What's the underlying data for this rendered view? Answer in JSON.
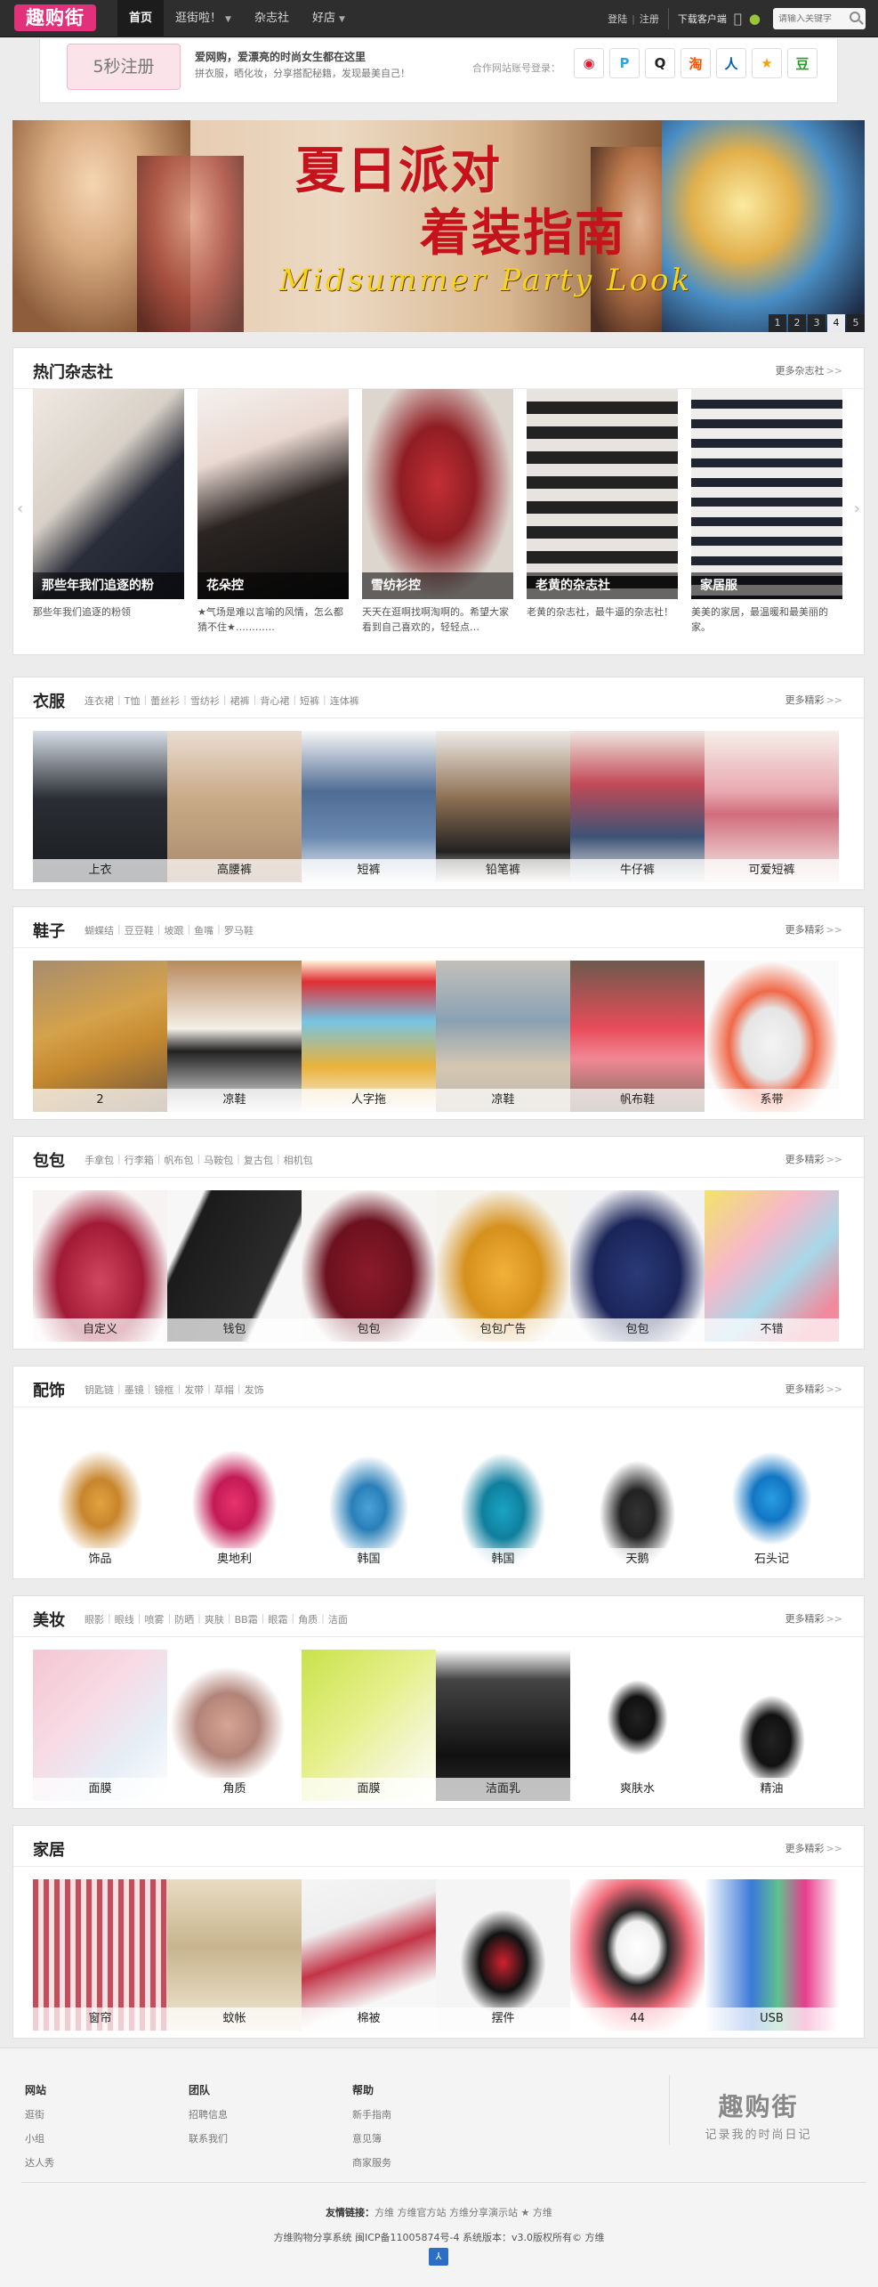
{
  "topbar": {
    "logo": "趣购街",
    "nav": [
      {
        "label": "首页",
        "active": true,
        "dropdown": false
      },
      {
        "label": "逛街啦！",
        "active": false,
        "dropdown": true
      },
      {
        "label": "杂志社",
        "active": false,
        "dropdown": false
      },
      {
        "label": "好店",
        "active": false,
        "dropdown": true
      }
    ],
    "login": "登陆",
    "register": "注册",
    "download": "下载客户端",
    "search_placeholder": "请输入关键字"
  },
  "regbar": {
    "button": "5秒注册",
    "slogan": "爱网购，爱漂亮的时尚女生都在这里",
    "subslogan": "拼衣服，晒化妆，分享搭配秘籍，发现最美自己！",
    "partner_label": "合作网站账号登录：",
    "partners": [
      {
        "icon": "weibo-icon",
        "glyph": "◉",
        "color": "#e6162d"
      },
      {
        "icon": "pengyou-icon",
        "glyph": "P",
        "color": "#2ea7e0"
      },
      {
        "icon": "qq-icon",
        "glyph": "Q",
        "color": "#222222"
      },
      {
        "icon": "taobao-icon",
        "glyph": "淘",
        "color": "#ff5000"
      },
      {
        "icon": "renren-icon",
        "glyph": "人",
        "color": "#005eac"
      },
      {
        "icon": "kaixin-icon",
        "glyph": "★",
        "color": "#f7a000"
      },
      {
        "icon": "douban-icon",
        "glyph": "豆",
        "color": "#2f9833"
      }
    ]
  },
  "banner": {
    "title1": "夏日派对",
    "title2": "着装指南",
    "subtitle": "Midsummer Party Look",
    "dots": [
      "1",
      "2",
      "3",
      "4",
      "5"
    ],
    "active_dot": 4
  },
  "magazine": {
    "title": "热门杂志社",
    "more": "更多杂志社",
    "items": [
      {
        "caption": "那些年我们追逐的粉",
        "desc": "那些年我们追逐的粉领",
        "bg": "linear-gradient(135deg,#efe9e1 0%,#d9d1c8 40%,#2b2e3a 60%,#1b1f2b 100%)"
      },
      {
        "caption": "花朵控",
        "desc": "★气场是难以言喻的风情，怎么都猜不住★…………",
        "bg": "linear-gradient(160deg,#f4f1ee 0%,#ead9d2 30%,#2a2422 55%,#111 100%)"
      },
      {
        "caption": "雪纺衫控",
        "desc": "天天在逛啊找啊淘啊的。希望大家看到自己喜欢的，轻轻点…",
        "bg": "radial-gradient(ellipse at 50% 45%,#c22f34 0,#8f1d24 35%,#ddd6cf 70%)"
      },
      {
        "caption": "老黄的杂志社",
        "desc": "老黄的杂志社，最牛逼的杂志社！",
        "bg": "repeating-linear-gradient(180deg,#e7e3df 0 14px,#222 14px 28px)"
      },
      {
        "caption": "家居服",
        "desc": "美美的家居，最温暖和最美丽的家。",
        "bg": "repeating-linear-gradient(180deg,#f0eeec 0 12px,#1f2430 12px 22px)"
      }
    ]
  },
  "sections": [
    {
      "name": "clothing",
      "title": "衣服",
      "tags": [
        "连衣裙",
        "T恤",
        "蕾丝衫",
        "雪纺衫",
        "裙裤",
        "背心裙",
        "短裤",
        "连体裤"
      ],
      "more": "更多精彩",
      "items": [
        {
          "label": "上衣",
          "bg": "linear-gradient(180deg,#d6dde6 0%,#2a2d33 45%,#1a1c20 100%)"
        },
        {
          "label": "高腰裤",
          "bg": "linear-gradient(180deg,#e9ddd2 0%,#c9aa86 45%,#a88a6e 100%)"
        },
        {
          "label": "短裤",
          "bg": "linear-gradient(180deg,#f6f6f6 0%,#4f6d94 40%,#6a89b0 70%,#f4f4f4 100%)"
        },
        {
          "label": "铅笔裤",
          "bg": "linear-gradient(180deg,#efece8 0%,#8c6f52 45%,#222 80%,#efece8 100%)"
        },
        {
          "label": "牛仔裤",
          "bg": "linear-gradient(180deg,#efe6e0 0%,#c24a56 35%,#3d5376 70%,#ece9e6 100%)"
        },
        {
          "label": "可爱短裤",
          "bg": "linear-gradient(180deg,#f6efe9 0%,#e8a9b1 40%,#d16d7c 55%,#f5f0ec 100%)"
        }
      ]
    },
    {
      "name": "shoes",
      "title": "鞋子",
      "tags": [
        "蝴蝶结",
        "豆豆鞋",
        "坡跟",
        "鱼嘴",
        "罗马鞋"
      ],
      "more": "更多精彩",
      "items": [
        {
          "label": "2",
          "bg": "linear-gradient(160deg,#a78c6d 0%,#d4a24b 40%,#c68a30 60%,#6d543c 100%)"
        },
        {
          "label": "凉鞋",
          "bg": "linear-gradient(180deg,#b88a5d 0%,#f4efe8 45%,#222 60%,#f2f2f2 100%)"
        },
        {
          "label": "人字拖",
          "bg": "linear-gradient(180deg,#fff4d8 0%,#e12e34 14%,#76c4e3 40%,#e9b23a 70%,#f5f5f5 100%)"
        },
        {
          "label": "凉鞋",
          "bg": "linear-gradient(180deg,#c3c0ba 0%,#8aa1b3 40%,#d5c7b1 70%,#bdb7ad 100%)"
        },
        {
          "label": "帆布鞋",
          "bg": "linear-gradient(180deg,#6c5a4c 0%,#e84c5a 45%,#f08894 65%,#7a6a5c 100%)"
        },
        {
          "label": "系带",
          "bg": "radial-gradient(ellipse at 50% 55%,#f4f4f4 0,#e5e5e5 30%,#f06848 45%,#fafafa 70%)"
        }
      ]
    },
    {
      "name": "bags",
      "title": "包包",
      "tags": [
        "手拿包",
        "行李箱",
        "帆布包",
        "马鞍包",
        "复古包",
        "相机包"
      ],
      "more": "更多精彩",
      "items": [
        {
          "label": "自定义",
          "bg": "radial-gradient(ellipse at 50% 60%,#d2455f 0,#a11a36 45%,#f7f3f3 75%)"
        },
        {
          "label": "钱包",
          "bg": "linear-gradient(115deg,#f7f7f7 0%,#f7f7f7 18%,#1b1b1b 22%,#2b2b2b 70%,#f7f7f7 74%)"
        },
        {
          "label": "包包",
          "bg": "radial-gradient(ellipse at 50% 55%,#8a1a2b 0,#6c111f 45%,#f7f5f4 72%)"
        },
        {
          "label": "包包广告",
          "bg": "radial-gradient(ellipse at 50% 55%,#f1b23a 0,#d6901c 40%,#f5f3ee 72%)"
        },
        {
          "label": "包包",
          "bg": "radial-gradient(ellipse at 50% 55%,#2a3a78 0,#1a2458 45%,#f3f3f6 75%)"
        },
        {
          "label": "不错",
          "bg": "linear-gradient(135deg,#f2e46a 0%,#f6b8c8 35%,#a7d7e8 60%,#f08a9c 85%)"
        }
      ]
    },
    {
      "name": "accessories",
      "title": "配饰",
      "tags": [
        "钥匙链",
        "墨镜",
        "镜框",
        "发带",
        "草帽",
        "发饰"
      ],
      "more": "更多精彩",
      "items": [
        {
          "label": "饰品",
          "bg": "radial-gradient(ellipse at 50% 55%,#e2a343 0,#c8852c 20%,#fff 45%)"
        },
        {
          "label": "奥地利",
          "bg": "radial-gradient(ellipse at 50% 55%,#e8336e 0,#c31a55 22%,#fff 45%)"
        },
        {
          "label": "韩国",
          "bg": "radial-gradient(ellipse at 50% 58%,#4aa3d8 0,#2a7fb8 18%,#fff 42%)"
        },
        {
          "label": "韩国",
          "bg": "radial-gradient(ellipse at 50% 60%,#1ba4c4 0,#0f7f9d 22%,#fff 45%)"
        },
        {
          "label": "天鹅",
          "bg": "radial-gradient(ellipse at 50% 62%,#333 0,#222 18%,#fff 40%)"
        },
        {
          "label": "石头记",
          "bg": "radial-gradient(ellipse at 50% 52%,#2a9ee3 0,#1176c4 20%,#fff 42%)"
        }
      ]
    },
    {
      "name": "makeup",
      "title": "美妆",
      "tags": [
        "眼影",
        "眼线",
        "喷雾",
        "防晒",
        "爽肤",
        "BB霜",
        "眼霜",
        "角质",
        "洁面"
      ],
      "more": "更多精彩",
      "items": [
        {
          "label": "面膜",
          "bg": "linear-gradient(135deg,#f3c6d3 0%,#f7dbe4 40%,#e6eef6 70%,#fff 100%)"
        },
        {
          "label": "角质",
          "bg": "radial-gradient(ellipse at 45% 50%,#d7a494 0,#b28479 30%,#fff 55%)"
        },
        {
          "label": "面膜",
          "bg": "linear-gradient(135deg,#c9e24a 0%,#e6f08c 45%,#f1f5c6 70%,#fff 100%)"
        },
        {
          "label": "洁面乳",
          "bg": "linear-gradient(180deg,#fff 0%,#444 20%,#111 70%,#2b2b2b 100%)"
        },
        {
          "label": "爽肤水",
          "bg": "radial-gradient(ellipse at 50% 45%,#222 0,#111 18%,#fff 32%)"
        },
        {
          "label": "精油",
          "bg": "radial-gradient(ellipse at 50% 60%,#222 0,#111 20%,#fff 35%)"
        }
      ]
    },
    {
      "name": "home",
      "title": "家居",
      "tags": [],
      "more": "更多精彩",
      "items": [
        {
          "label": "窗帘",
          "bg": "repeating-linear-gradient(90deg,#c84b5a 0 6px,#f4e2e2 6px 12px)"
        },
        {
          "label": "蚊帐",
          "bg": "linear-gradient(180deg,#e8dcc2 0%,#c8b58f 45%,#f0e7d4 100%)"
        },
        {
          "label": "棉被",
          "bg": "linear-gradient(160deg,#f5f5f5 0%,#eee 30%,#c23447 50%,#f7f7f7 75%)"
        },
        {
          "label": "摆件",
          "bg": "radial-gradient(ellipse at 50% 55%,#d1222e 0,#111 25%,#f5f5f5 45%)"
        },
        {
          "label": "44",
          "bg": "radial-gradient(ellipse at 50% 45%,#fff 0,#f1f1f1 22%,#222 32%,#f06a7a 55%,#fff 80%)"
        },
        {
          "label": "USB",
          "bg": "linear-gradient(90deg,#fff 0%,#3b79d8 35%,#60c18e 55%,#e83c8d 75%,#fff 100%)"
        }
      ]
    }
  ],
  "footer": {
    "columns": [
      {
        "title": "网站",
        "links": [
          "逛街",
          "小组",
          "达人秀"
        ]
      },
      {
        "title": "团队",
        "links": [
          "招聘信息",
          "联系我们"
        ]
      },
      {
        "title": "帮助",
        "links": [
          "新手指南",
          "意见簿",
          "商家服务"
        ]
      }
    ],
    "logo": "趣购街",
    "logo_sub": "记录我的时尚日记",
    "friend_label": "友情链接：",
    "friend_links": "方维  方维官方站  方维分享演示站  ★ 方维",
    "copyright": "方维购物分享系统  闽ICP备11005874号-4  系统版本：v3.0版权所有© 方维",
    "badge": "⅄"
  }
}
